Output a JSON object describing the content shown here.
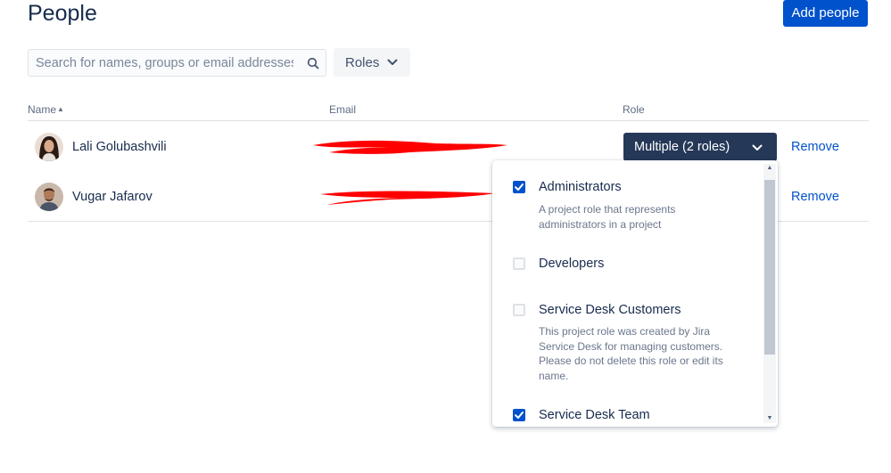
{
  "header": {
    "title": "People",
    "add_button_label": "Add people"
  },
  "filters": {
    "search_placeholder": "Search for names, groups or email addresses",
    "search_value": "",
    "roles_label": "Roles"
  },
  "table": {
    "columns": {
      "name": "Name",
      "email": "Email",
      "role": "Role"
    },
    "rows": [
      {
        "name": "Lali Golubashvili",
        "email_redacted": true,
        "role": "Multiple (2 roles)",
        "action": "Remove"
      },
      {
        "name": "Vugar Jafarov",
        "email_redacted": true,
        "email_visible_fragment": "...",
        "action": "Remove"
      }
    ]
  },
  "role_dropdown": {
    "options": [
      {
        "label": "Administrators",
        "checked": true,
        "description": "A project role that represents administrators in a project"
      },
      {
        "label": "Developers",
        "checked": false,
        "description": ""
      },
      {
        "label": "Service Desk Customers",
        "checked": false,
        "description": "This project role was created by Jira Service Desk for managing customers. Please do not delete this role or edit its name."
      },
      {
        "label": "Service Desk Team",
        "checked": true,
        "description": ""
      }
    ]
  },
  "colors": {
    "primary": "#0052cc",
    "role_select_bg": "#253858",
    "text": "#172b4d",
    "redaction": "#ff0000"
  }
}
